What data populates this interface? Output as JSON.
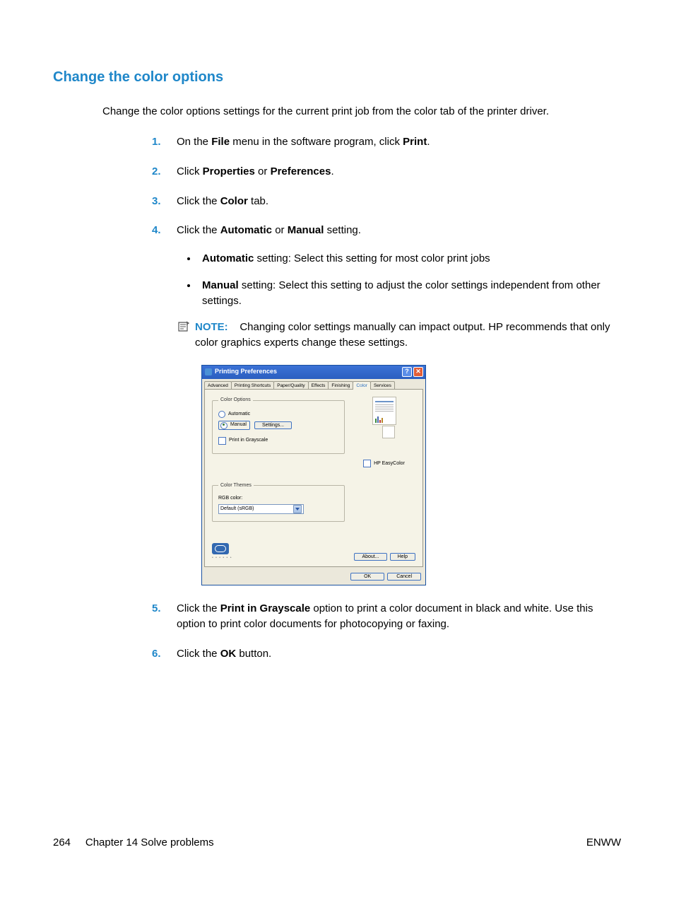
{
  "heading": "Change the color options",
  "intro": "Change the color options settings for the current print job from the color tab of the printer driver.",
  "steps": {
    "s1_pre": "On the ",
    "s1_b1": "File",
    "s1_mid": " menu in the software program, click ",
    "s1_b2": "Print",
    "s1_post": ".",
    "s2_pre": "Click ",
    "s2_b1": "Properties",
    "s2_mid": " or ",
    "s2_b2": "Preferences",
    "s2_post": ".",
    "s3_pre": "Click the ",
    "s3_b1": "Color",
    "s3_post": " tab.",
    "s4_pre": "Click the ",
    "s4_b1": "Automatic",
    "s4_mid": " or ",
    "s4_b2": "Manual",
    "s4_post": " setting.",
    "s4a_b": "Automatic",
    "s4a_txt": " setting: Select this setting for most color print jobs",
    "s4b_b": "Manual",
    "s4b_txt": " setting: Select this setting to adjust the color settings independent from other settings.",
    "note_label": "NOTE:",
    "note_txt": "Changing color settings manually can impact output. HP recommends that only color graphics experts change these settings.",
    "s5_pre": "Click the ",
    "s5_b1": "Print in Grayscale",
    "s5_post": " option to print a color document in black and white. Use this option to print color documents for photocopying or faxing.",
    "s6_pre": "Click the ",
    "s6_b1": "OK",
    "s6_post": " button."
  },
  "dialog": {
    "title": "Printing Preferences",
    "tabs": [
      "Advanced",
      "Printing Shortcuts",
      "Paper/Quality",
      "Effects",
      "Finishing",
      "Color",
      "Services"
    ],
    "active_tab": "Color",
    "group_options": "Color Options",
    "radio_auto": "Automatic",
    "radio_manual": "Manual",
    "settings_btn": "Settings...",
    "chk_grayscale": "Print in Grayscale",
    "chk_easycolor": "HP EasyColor",
    "group_themes": "Color Themes",
    "rgb_label": "RGB color:",
    "rgb_value": "Default (sRGB)",
    "about_btn": "About...",
    "help_btn": "Help",
    "ok_btn": "OK",
    "cancel_btn": "Cancel"
  },
  "footer": {
    "page_num": "264",
    "chapter": "Chapter 14   Solve problems",
    "right": "ENWW"
  }
}
